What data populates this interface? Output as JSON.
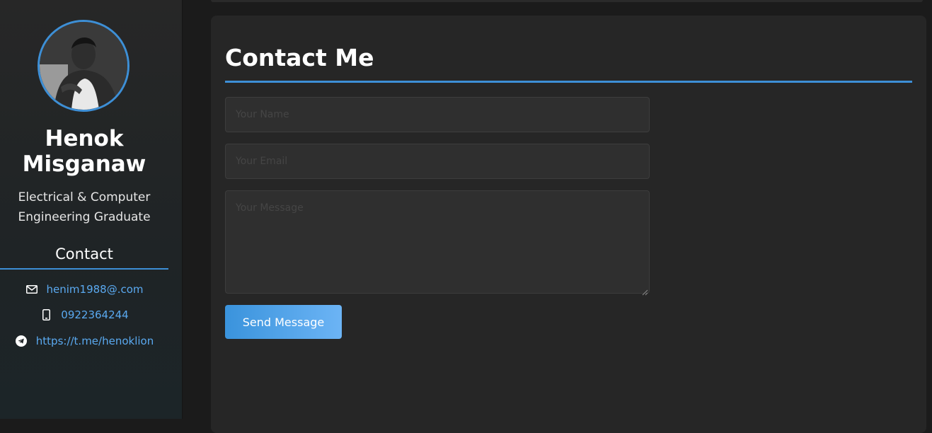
{
  "profile": {
    "name": "Henok Misganaw",
    "role": "Electrical & Computer Engineering Graduate",
    "avatar_icon": "profile-photo"
  },
  "sidebar_contact": {
    "heading": "Contact",
    "email": {
      "icon": "envelope-icon",
      "text": "henim1988@.com"
    },
    "phone": {
      "icon": "phone-icon",
      "text": "0922364244"
    },
    "telegram": {
      "icon": "telegram-icon",
      "text": "https://t.me/henoklion"
    }
  },
  "contact_form": {
    "title": "Contact Me",
    "name_placeholder": "Your Name",
    "email_placeholder": "Your Email",
    "message_placeholder": "Your Message",
    "name_value": "",
    "email_value": "",
    "message_value": "",
    "submit_label": "Send Message"
  },
  "colors": {
    "accent": "#3d8fd6",
    "link": "#5aa9f0",
    "background": "#1b1b1b",
    "card": "#262626"
  }
}
